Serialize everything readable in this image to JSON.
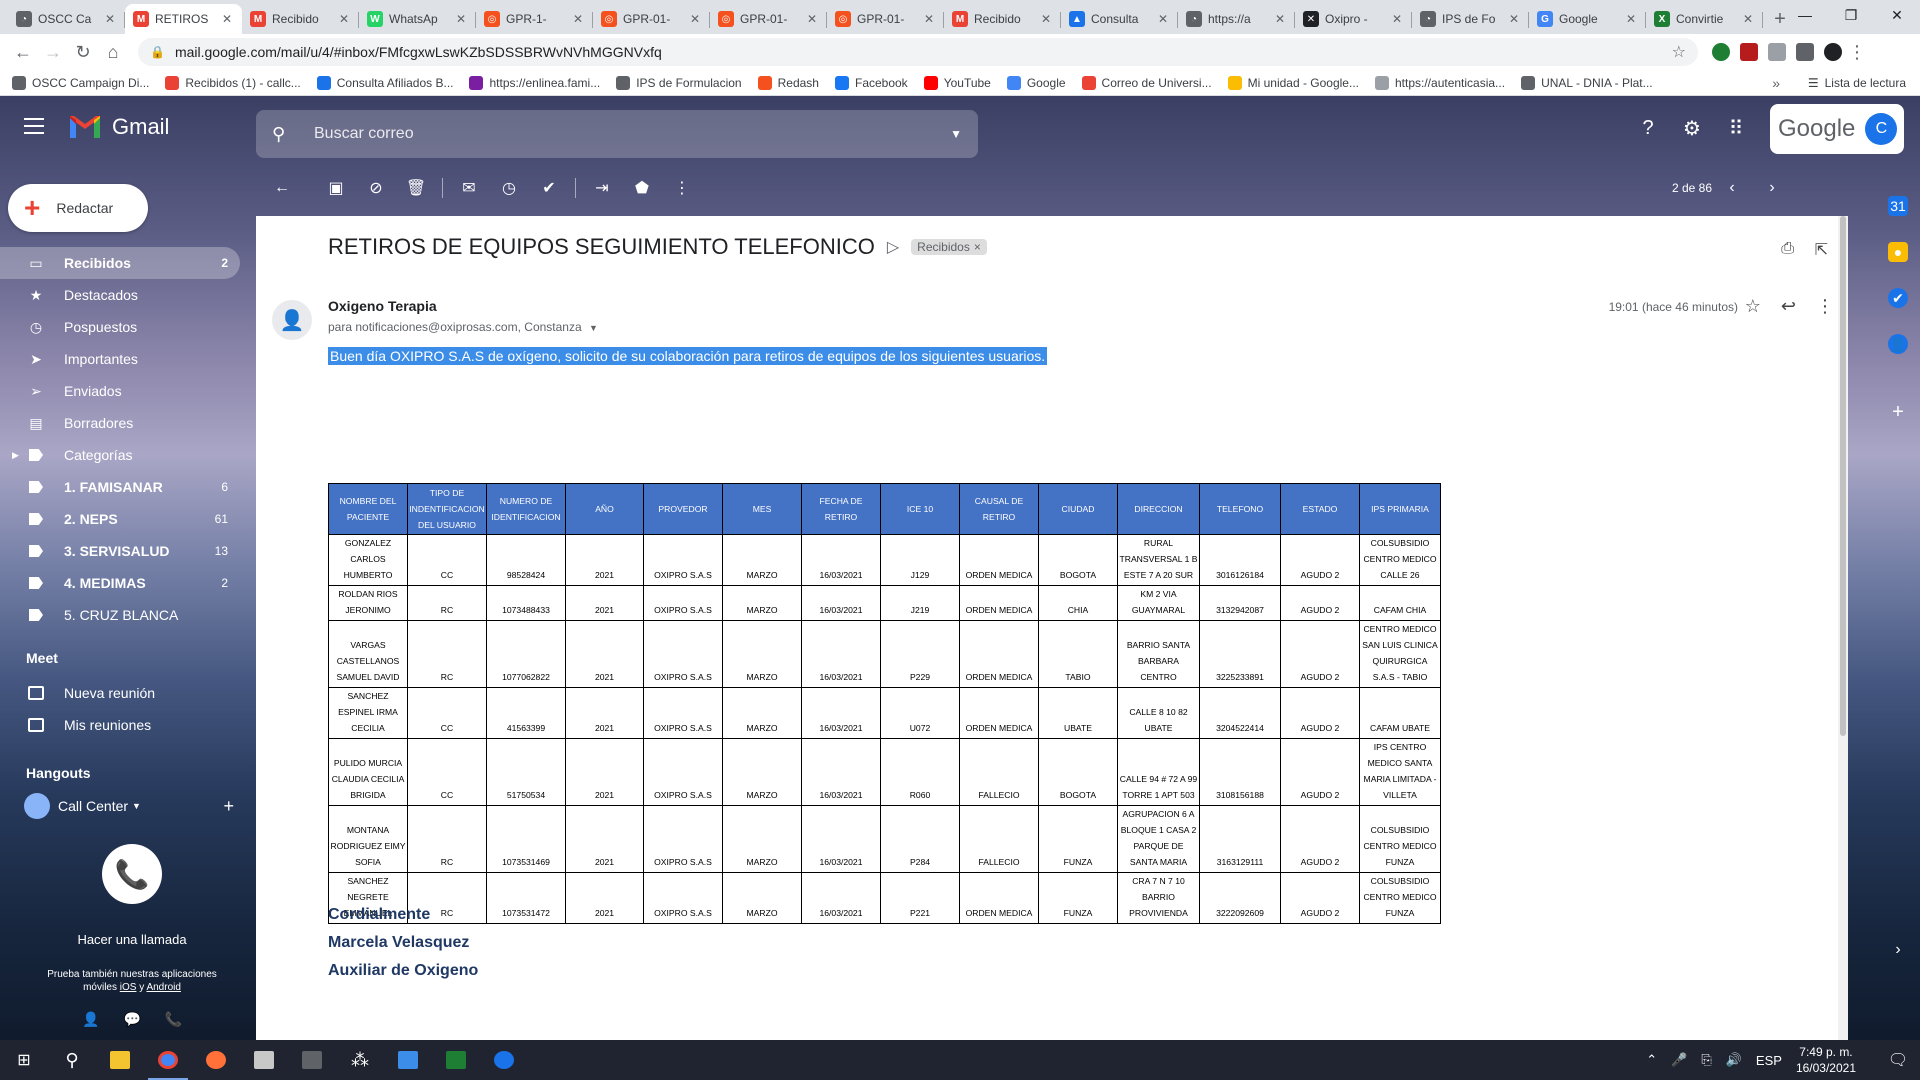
{
  "browser": {
    "tabs": [
      {
        "label": "OSCC Ca",
        "color": "#5f6368",
        "glyph": "◔",
        "active": false
      },
      {
        "label": "RETIROS",
        "color": "#ea4335",
        "glyph": "M",
        "active": true
      },
      {
        "label": "Recibido",
        "color": "#ea4335",
        "glyph": "M",
        "active": false
      },
      {
        "label": "WhatsAp",
        "color": "#25d366",
        "glyph": "W",
        "active": false
      },
      {
        "label": "GPR-1-",
        "color": "#f4511e",
        "glyph": "◎",
        "active": false
      },
      {
        "label": "GPR-01-",
        "color": "#f4511e",
        "glyph": "◎",
        "active": false
      },
      {
        "label": "GPR-01-",
        "color": "#f4511e",
        "glyph": "◎",
        "active": false
      },
      {
        "label": "GPR-01-",
        "color": "#f4511e",
        "glyph": "◎",
        "active": false
      },
      {
        "label": "Recibido",
        "color": "#ea4335",
        "glyph": "M",
        "active": false
      },
      {
        "label": "Consulta",
        "color": "#1a73e8",
        "glyph": "▲",
        "active": false
      },
      {
        "label": "https://a",
        "color": "#5f6368",
        "glyph": "◔",
        "active": false
      },
      {
        "label": "Oxipro -",
        "color": "#202124",
        "glyph": "✕",
        "active": false
      },
      {
        "label": "IPS de Fo",
        "color": "#5f6368",
        "glyph": "◔",
        "active": false
      },
      {
        "label": "Google",
        "color": "#4285f4",
        "glyph": "G",
        "active": false
      },
      {
        "label": "Convirtie",
        "color": "#1e7e34",
        "glyph": "X",
        "active": false
      }
    ],
    "url": "mail.google.com/mail/u/4/#inbox/FMfcgxwLswKZbSDSSBRWvNVhMGGNVxfq",
    "bookmarks": [
      {
        "label": "OSCC Campaign Di...",
        "color": "#5f6368"
      },
      {
        "label": "Recibidos (1) - callc...",
        "color": "#ea4335"
      },
      {
        "label": "Consulta Afiliados B...",
        "color": "#1a73e8"
      },
      {
        "label": "https://enlinea.fami...",
        "color": "#7b1fa2"
      },
      {
        "label": "IPS de Formulacion",
        "color": "#5f6368"
      },
      {
        "label": "Redash",
        "color": "#f4511e"
      },
      {
        "label": "Facebook",
        "color": "#1877f2"
      },
      {
        "label": "YouTube",
        "color": "#ff0000"
      },
      {
        "label": "Google",
        "color": "#4285f4"
      },
      {
        "label": "Correo de Universi...",
        "color": "#ea4335"
      },
      {
        "label": "Mi unidad - Google...",
        "color": "#fbbc04"
      },
      {
        "label": "https://autenticasia...",
        "color": "#9aa0a6"
      },
      {
        "label": "UNAL - DNIA - Plat...",
        "color": "#5f6368"
      }
    ],
    "bookmarks_more": "»",
    "reading_list": "Lista de lectura"
  },
  "gmail": {
    "app_name": "Gmail",
    "search_placeholder": "Buscar correo",
    "google_word": "Google",
    "avatar_letter": "C",
    "compose_label": "Redactar",
    "nav": [
      {
        "label": "Recibidos",
        "count": "2",
        "icon": "inbox",
        "active": true,
        "bold": true
      },
      {
        "label": "Destacados",
        "count": "",
        "icon": "star",
        "active": false,
        "bold": false
      },
      {
        "label": "Pospuestos",
        "count": "",
        "icon": "clock",
        "active": false,
        "bold": false
      },
      {
        "label": "Importantes",
        "count": "",
        "icon": "important",
        "active": false,
        "bold": false
      },
      {
        "label": "Enviados",
        "count": "",
        "icon": "send",
        "active": false,
        "bold": false
      },
      {
        "label": "Borradores",
        "count": "",
        "icon": "draft",
        "active": false,
        "bold": false
      },
      {
        "label": "Categorías",
        "count": "",
        "icon": "label",
        "active": false,
        "bold": false,
        "caret": true
      },
      {
        "label": "1. FAMISANAR",
        "count": "6",
        "icon": "label",
        "active": false,
        "bold": true
      },
      {
        "label": "2. NEPS",
        "count": "61",
        "icon": "label",
        "active": false,
        "bold": true
      },
      {
        "label": "3. SERVISALUD",
        "count": "13",
        "icon": "label",
        "active": false,
        "bold": true
      },
      {
        "label": "4. MEDIMAS",
        "count": "2",
        "icon": "label",
        "active": false,
        "bold": true
      },
      {
        "label": "5. CRUZ BLANCA",
        "count": "",
        "icon": "label",
        "active": false,
        "bold": false
      }
    ],
    "meet_title": "Meet",
    "meet_new": "Nueva reunión",
    "meet_mine": "Mis reuniones",
    "hangouts_title": "Hangouts",
    "hangouts_user": "Call Center",
    "call_text": "Hacer una llamada",
    "call_sub_prefix": "Prueba también nuestras aplicaciones móviles",
    "call_sub_ios": "iOS",
    "call_sub_and": "y",
    "call_sub_android": "Android",
    "pager": "2 de 86"
  },
  "message": {
    "subject": "RETIROS DE EQUIPOS SEGUIMIENTO TELEFONICO",
    "label_chip": "Recibidos",
    "sender": "Oxigeno Terapia",
    "recipients": "para notificaciones@oxiprosas.com, Constanza",
    "time": "19:01 (hace 46 minutos)",
    "intro": "Buen día OXIPRO S.A.S de oxígeno, solicito de su colaboración para retiros de equipos de los siguientes usuarios.",
    "table": {
      "headers": [
        "NOMBRE DEL PACIENTE",
        "TIPO DE INDENTIFICACION DEL USUARIO",
        "NUMERO DE IDENTIFICACION",
        "AÑO",
        "PROVEDOR",
        "MES",
        "FECHA DE RETIRO",
        "ICE 10",
        "CAUSAL DE RETIRO",
        "CIUDAD",
        "DIRECCION",
        "TELEFONO",
        "ESTADO",
        "IPS PRIMARIA"
      ],
      "rows": [
        [
          "GONZALEZ CARLOS HUMBERTO",
          "CC",
          "98528424",
          "2021",
          "OXIPRO S.A.S",
          "MARZO",
          "16/03/2021",
          "J129",
          "ORDEN MEDICA",
          "BOGOTA",
          "RURAL TRANSVERSAL 1 B ESTE 7 A 20 SUR",
          "3016126184",
          "AGUDO 2",
          "COLSUBSIDIO CENTRO MEDICO CALLE 26"
        ],
        [
          "ROLDAN RIOS JERONIMO",
          "RC",
          "1073488433",
          "2021",
          "OXIPRO S.A.S",
          "MARZO",
          "16/03/2021",
          "J219",
          "ORDEN MEDICA",
          "CHIA",
          "KM 2 VIA GUAYMARAL",
          "3132942087",
          "AGUDO 2",
          "CAFAM CHIA"
        ],
        [
          "VARGAS CASTELLANOS SAMUEL DAVID",
          "RC",
          "1077062822",
          "2021",
          "OXIPRO S.A.S",
          "MARZO",
          "16/03/2021",
          "P229",
          "ORDEN MEDICA",
          "TABIO",
          "BARRIO SANTA BARBARA CENTRO",
          "3225233891",
          "AGUDO 2",
          "CENTRO MEDICO SAN LUIS CLINICA QUIRURGICA S.A.S - TABIO"
        ],
        [
          "SANCHEZ ESPINEL IRMA CECILIA",
          "CC",
          "41563399",
          "2021",
          "OXIPRO S.A.S",
          "MARZO",
          "16/03/2021",
          "U072",
          "ORDEN MEDICA",
          "UBATE",
          "CALLE 8 10 82 UBATE",
          "3204522414",
          "AGUDO 2",
          "CAFAM UBATE"
        ],
        [
          "PULIDO MURCIA CLAUDIA CECILIA BRIGIDA",
          "CC",
          "51750534",
          "2021",
          "OXIPRO S.A.S",
          "MARZO",
          "16/03/2021",
          "R060",
          "FALLECIO",
          "BOGOTA",
          "CALLE 94 # 72 A 99 TORRE 1 APT 503",
          "3108156188",
          "AGUDO 2",
          "IPS CENTRO MEDICO SANTA MARIA LIMITADA - VILLETA"
        ],
        [
          "MONTANA RODRIGUEZ EIMY SOFIA",
          "RC",
          "1073531469",
          "2021",
          "OXIPRO S.A.S",
          "MARZO",
          "16/03/2021",
          "P284",
          "FALLECIO",
          "FUNZA",
          "AGRUPACION 6 A BLOQUE 1 CASA 2 PARQUE DE SANTA MARIA",
          "3163129111",
          "AGUDO 2",
          "COLSUBSIDIO CENTRO MEDICO FUNZA"
        ],
        [
          "SANCHEZ NEGRETE EMMANUEL",
          "RC",
          "1073531472",
          "2021",
          "OXIPRO S.A.S",
          "MARZO",
          "16/03/2021",
          "P221",
          "ORDEN MEDICA",
          "FUNZA",
          "CRA 7 N 7 10 BARRIO PROVIVIENDA",
          "3222092609",
          "AGUDO 2",
          "COLSUBSIDIO CENTRO MEDICO FUNZA"
        ]
      ]
    },
    "signature": [
      "Cordialmente",
      "Marcela Velasquez",
      "Auxiliar de Oxigeno"
    ]
  },
  "taskbar": {
    "lang": "ESP",
    "time": "7:49 p. m.",
    "date": "16/03/2021"
  },
  "colors": {
    "accent_blue": "#1a73e8",
    "selection_blue": "#3b8de8",
    "table_header": "#4472c4",
    "signature_navy": "#1f3864"
  }
}
